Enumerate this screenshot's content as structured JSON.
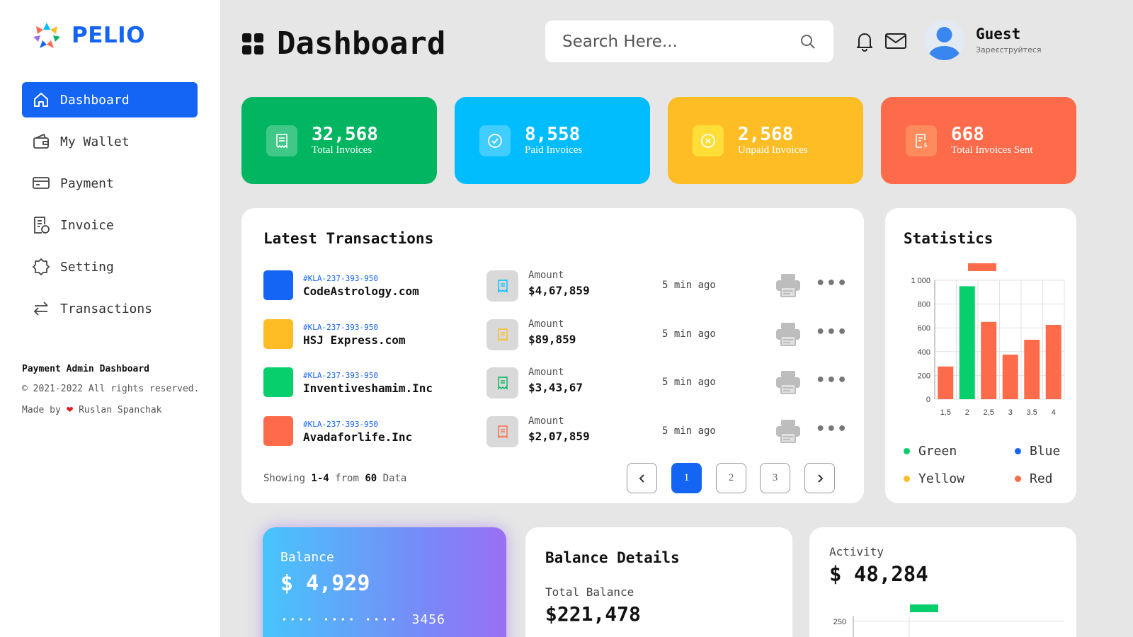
{
  "brand": {
    "name": "PELIO"
  },
  "sidebar": {
    "items": [
      {
        "label": "Dashboard",
        "icon": "home-icon",
        "active": true
      },
      {
        "label": "My Wallet",
        "icon": "wallet-icon",
        "active": false
      },
      {
        "label": "Payment",
        "icon": "credit-card-icon",
        "active": false
      },
      {
        "label": "Invoice",
        "icon": "invoice-icon",
        "active": false
      },
      {
        "label": "Setting",
        "icon": "gear-icon",
        "active": false
      },
      {
        "label": "Transactions",
        "icon": "transfer-arrows-icon",
        "active": false
      }
    ],
    "footer": {
      "title": "Payment Admin Dashboard",
      "copyright": "© 2021-2022 All rights reserved.",
      "made_by_prefix": "Made by",
      "author": "Ruslan Spanchak"
    }
  },
  "header": {
    "title": "Dashboard",
    "search_placeholder": "Search Here...",
    "user": {
      "name": "Guest",
      "subtitle": "Зареєструйтеся"
    }
  },
  "stats": [
    {
      "value": "32,568",
      "label": "Total Invoices",
      "color": "#02b661"
    },
    {
      "value": "8,558",
      "label": "Paid Invoices",
      "color": "#02bdfd"
    },
    {
      "value": "2,568",
      "label": "Unpaid Invoices",
      "color": "#febd25"
    },
    {
      "value": "668",
      "label": "Total Invoices Sent",
      "color": "#fe6b4a"
    }
  ],
  "transactions": {
    "title": "Latest Transactions",
    "amount_label": "Amount",
    "rows": [
      {
        "id": "#KLA-237-393-950",
        "name": "CodeAstrology.com",
        "amount": "$4,67,859",
        "time": "5 min ago",
        "color": "#1565f5"
      },
      {
        "id": "#KLA-237-393-950",
        "name": "HSJ Express.com",
        "amount": "$89,859",
        "time": "5 min ago",
        "color": "#febd25"
      },
      {
        "id": "#KLA-237-393-950",
        "name": "Inventiveshamim.Inc",
        "amount": "$3,43,67",
        "time": "5 min ago",
        "color": "#07cf6b"
      },
      {
        "id": "#KLA-237-393-950",
        "name": "Avadaforlife.Inc",
        "amount": "$2,07,859",
        "time": "5 min ago",
        "color": "#fe6b4a"
      }
    ],
    "showing_prefix": "Showing",
    "showing_range": "1-4",
    "showing_mid": "from",
    "showing_total": "60",
    "showing_suffix": "Data",
    "pages": [
      "1",
      "2",
      "3"
    ],
    "current_page": "1"
  },
  "statistics": {
    "title": "Statistics",
    "legend": [
      {
        "label": "Green",
        "color": "#07cf6b"
      },
      {
        "label": "Blue",
        "color": "#1565f5"
      },
      {
        "label": "Yellow",
        "color": "#febd25"
      },
      {
        "label": "Red",
        "color": "#fe6b4a"
      }
    ]
  },
  "chart_data": [
    {
      "type": "bar",
      "categories": [
        "1,5",
        "2",
        "2,5",
        "3",
        "3.5",
        "4"
      ],
      "series": [
        {
          "values": [
            275,
            950,
            650,
            375,
            500,
            625
          ],
          "colors": [
            "#fe6b4a",
            "#07cf6b",
            "#fe6b4a",
            "#fe6b4a",
            "#fe6b4a",
            "#fe6b4a"
          ]
        }
      ],
      "yticks": [
        "0",
        "200",
        "400",
        "600",
        "800",
        "1 000"
      ],
      "ylim": [
        0,
        1000
      ],
      "grid": true
    },
    {
      "type": "bar",
      "yticks": [
        "250"
      ],
      "grid": true
    }
  ],
  "balance": {
    "label": "Balance",
    "amount": "$ 4,929",
    "card_masked": "····  ····  ····",
    "card_last": "3456"
  },
  "balance_details": {
    "title": "Balance Details",
    "total_label": "Total Balance",
    "total_value": "$221,478"
  },
  "activity": {
    "label": "Activity",
    "value": "$ 48,284"
  }
}
